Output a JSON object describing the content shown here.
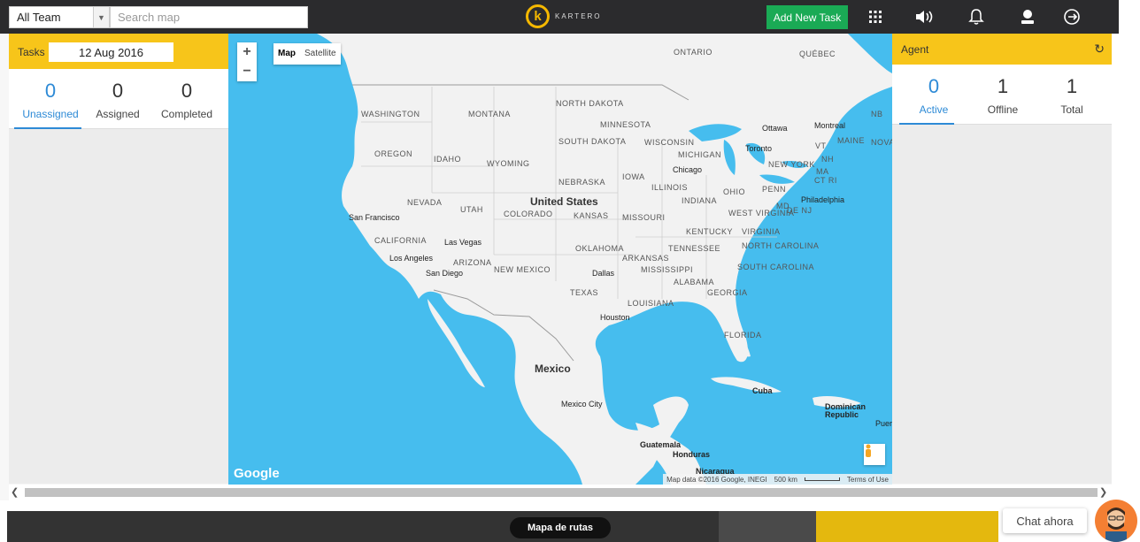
{
  "topbar": {
    "team_select": "All Team",
    "search_placeholder": "Search map",
    "logo_text": "KARTERO",
    "add_task_label": "Add New Task",
    "icons": [
      "grid-icon",
      "volume-icon",
      "bell-icon",
      "user-icon",
      "logout-icon"
    ]
  },
  "tasks": {
    "label": "Tasks",
    "date": "12 Aug 2016",
    "stats": [
      {
        "value": "0",
        "label": "Unassigned"
      },
      {
        "value": "0",
        "label": "Assigned"
      },
      {
        "value": "0",
        "label": "Completed"
      }
    ]
  },
  "map": {
    "type_map": "Map",
    "type_satellite": "Satellite",
    "google": "Google",
    "attribution": "Map data ©2016 Google, INEGI",
    "scale": "500 km",
    "terms": "Terms of Use",
    "labels": {
      "ontario": "ONTARIO",
      "quebec": "QUÉBEC",
      "north_dakota": "NORTH DAKOTA",
      "washington": "WASHINGTON",
      "montana": "MONTANA",
      "minnesota": "MINNESOTA",
      "nb": "NB",
      "oregon": "OREGON",
      "idaho": "IDAHO",
      "wyoming": "WYOMING",
      "south_dakota": "SOUTH DAKOTA",
      "wisconsin": "WISCONSIN",
      "michigan": "MICHIGAN",
      "ottawa": "Ottawa",
      "montreal": "Montreal",
      "maine": "MAINE",
      "nova": "NOVA",
      "vt": "VT",
      "nh": "NH",
      "toronto": "Toronto",
      "new_york": "NEW YORK",
      "ma": "MA",
      "ct_ri": "CT RI",
      "chicago": "Chicago",
      "iowa": "IOWA",
      "nebraska": "NEBRASKA",
      "illinois": "ILLINOIS",
      "ohio": "OHIO",
      "penn": "PENN",
      "nevada": "NEVADA",
      "utah": "UTAH",
      "united_states": "United States",
      "colorado": "COLORADO",
      "kansas": "KANSAS",
      "missouri": "MISSOURI",
      "indiana": "INDIANA",
      "md": "MD",
      "de_nj": "DE NJ",
      "philadelphia": "Philadelphia",
      "san_francisco": "San Francisco",
      "west_virginia": "WEST VIRGINIA",
      "kentucky": "KENTUCKY",
      "virginia": "VIRGINIA",
      "california": "CALIFORNIA",
      "las_vegas": "Las Vegas",
      "oklahoma": "OKLAHOMA",
      "tennessee": "TENNESSEE",
      "north_carolina": "NORTH CAROLINA",
      "los_angeles": "Los Angeles",
      "arizona": "ARIZONA",
      "arkansas": "ARKANSAS",
      "san_diego": "San Diego",
      "new_mexico": "NEW MEXICO",
      "dallas": "Dallas",
      "mississippi": "MISSISSIPPI",
      "south_carolina": "SOUTH CAROLINA",
      "alabama": "ALABAMA",
      "texas": "TEXAS",
      "georgia": "GEORGIA",
      "louisiana": "LOUISIANA",
      "houston": "Houston",
      "florida": "FLORIDA",
      "mexico": "Mexico",
      "cuba": "Cuba",
      "mexico_city": "Mexico City",
      "dominican_republic": "Dominican Republic",
      "puerto": "Puert",
      "guatemala": "Guatemala",
      "honduras": "Honduras",
      "nicaragua": "Nicaragua"
    }
  },
  "agent": {
    "label": "Agent",
    "stats": [
      {
        "value": "0",
        "label": "Active"
      },
      {
        "value": "1",
        "label": "Offline"
      },
      {
        "value": "1",
        "label": "Total"
      }
    ]
  },
  "bottom": {
    "routes_label": "Mapa de rutas",
    "chat_label": "Chat ahora"
  },
  "colors": {
    "accent_yellow": "#f7c51a",
    "active_blue": "#2d8ad6",
    "add_task_green": "#1aaa55",
    "water": "#46bdee"
  }
}
